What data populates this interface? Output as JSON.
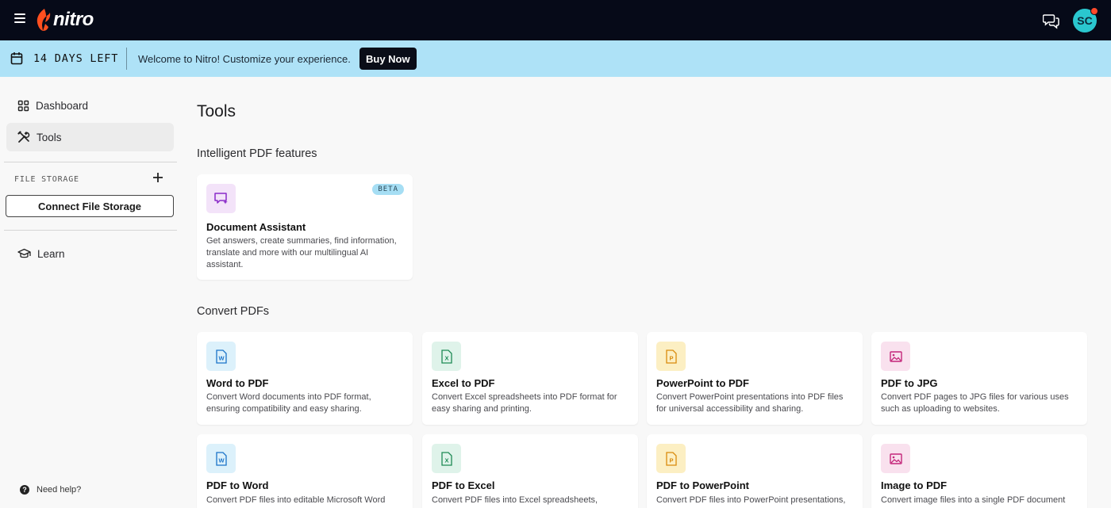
{
  "header": {
    "logo_text": "nitro",
    "avatar_initials": "SC"
  },
  "banner": {
    "days_left": "14 DAYS LEFT",
    "welcome": "Welcome to Nitro! Customize your experience.",
    "buy_now": "Buy Now"
  },
  "sidebar": {
    "dashboard": "Dashboard",
    "tools": "Tools",
    "file_storage_label": "FILE STORAGE",
    "connect_storage": "Connect File Storage",
    "learn": "Learn",
    "help": "Need help?"
  },
  "main": {
    "title": "Tools",
    "intelligent_section": "Intelligent PDF features",
    "convert_section": "Convert PDFs",
    "assistant": {
      "title": "Document Assistant",
      "badge": "BETA",
      "description": "Get answers, create summaries, find information, translate and more with our multilingual AI assistant."
    },
    "convert_tools": [
      {
        "title": "Word to PDF",
        "description": "Convert Word documents into PDF format, ensuring compatibility and easy sharing.",
        "icon": "word-file-icon"
      },
      {
        "title": "Excel to PDF",
        "description": "Convert Excel spreadsheets into PDF format for easy sharing and printing.",
        "icon": "excel-file-icon"
      },
      {
        "title": "PowerPoint to PDF",
        "description": "Convert PowerPoint presentations into PDF files for universal accessibility and sharing.",
        "icon": "powerpoint-file-icon"
      },
      {
        "title": "PDF to JPG",
        "description": "Convert PDF pages to JPG files for various uses such as uploading to websites.",
        "icon": "image-icon"
      },
      {
        "title": "PDF to Word",
        "description": "Convert PDF files into editable Microsoft Word",
        "icon": "word-file-icon"
      },
      {
        "title": "PDF to Excel",
        "description": "Convert PDF files into Excel spreadsheets,",
        "icon": "excel-file-icon"
      },
      {
        "title": "PDF to PowerPoint",
        "description": "Convert PDF files into PowerPoint presentations,",
        "icon": "powerpoint-file-icon"
      },
      {
        "title": "Image to PDF",
        "description": "Convert image files into a single PDF document for",
        "icon": "image-icon"
      }
    ]
  },
  "colors": {
    "topbar_bg": "#060a18",
    "banner_bg": "#aee2f7",
    "brand_orange": "#ff4f1f",
    "avatar_bg": "#2ac7cf",
    "word_blue": "#1a73c9",
    "excel_green": "#1e8a55",
    "powerpoint_orange": "#d98a0c",
    "image_pink": "#c4267a",
    "assistant_purple": "#8a2bc9"
  }
}
